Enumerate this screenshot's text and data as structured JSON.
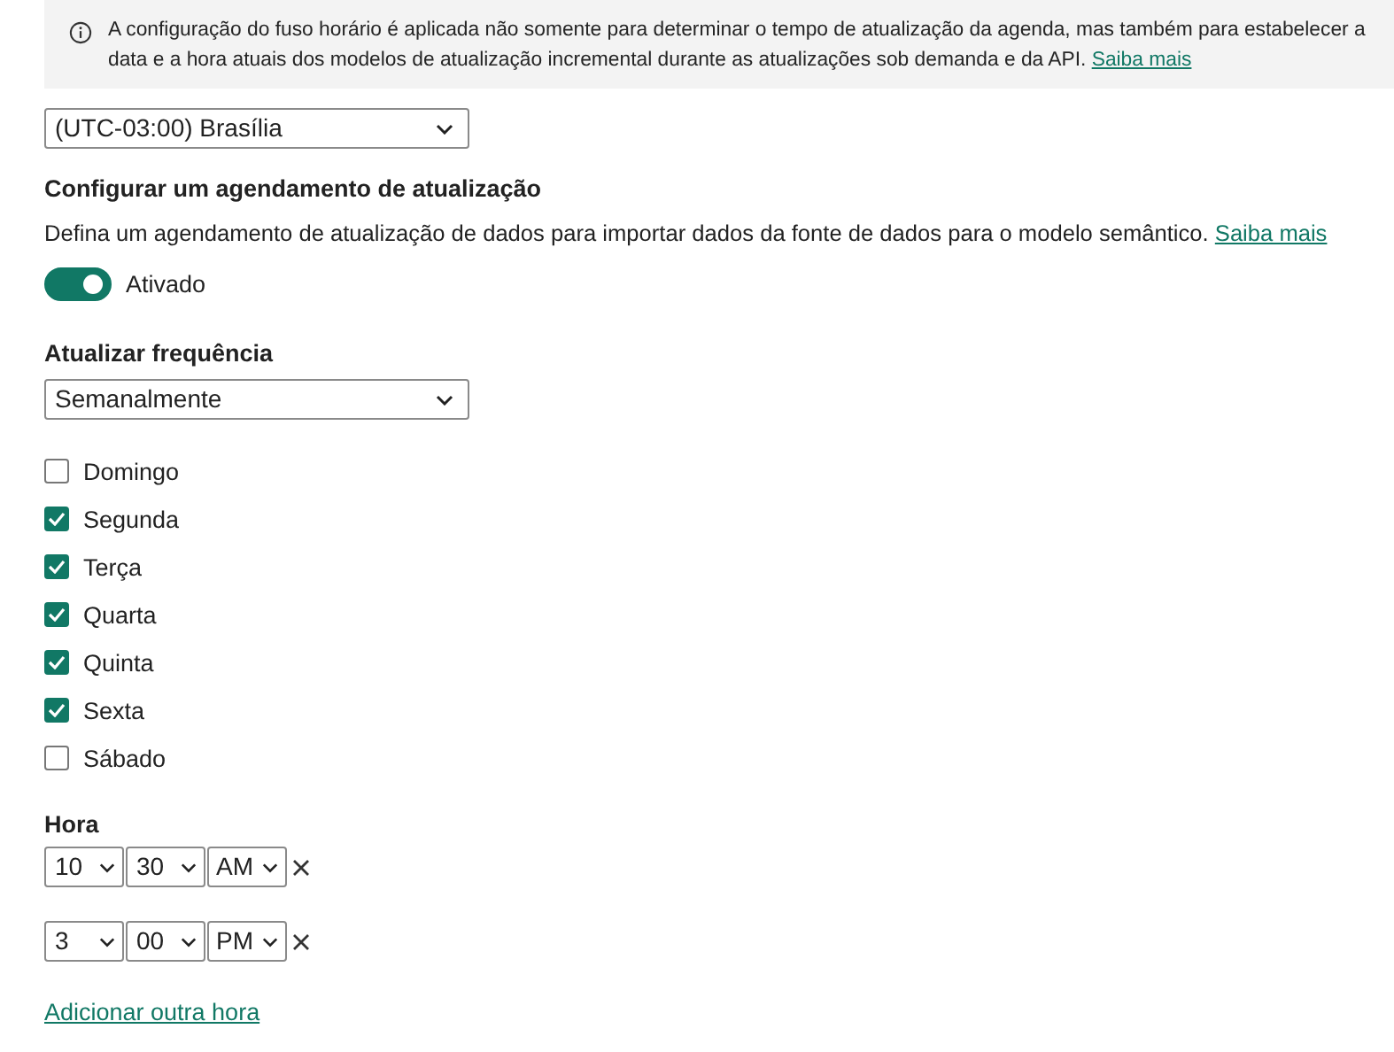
{
  "info_banner": {
    "text": "A configuração do fuso horário é aplicada não somente para determinar o tempo de atualização da agenda, mas também para estabelecer a data e a hora atuais dos modelos de atualização incremental durante as atualizações sob demanda e da API.",
    "link": "Saiba mais"
  },
  "timezone_dropdown": {
    "value": "(UTC-03:00) Brasília"
  },
  "schedule": {
    "heading": "Configurar um agendamento de atualização",
    "description": "Defina um agendamento de atualização de dados para importar dados da fonte de dados para o modelo semântico.",
    "link": "Saiba mais",
    "toggle": {
      "on": true,
      "label": "Ativado"
    }
  },
  "frequency": {
    "heading": "Atualizar frequência",
    "value": "Semanalmente"
  },
  "days": [
    {
      "label": "Domingo",
      "checked": false
    },
    {
      "label": "Segunda",
      "checked": true
    },
    {
      "label": "Terça",
      "checked": true
    },
    {
      "label": "Quarta",
      "checked": true
    },
    {
      "label": "Quinta",
      "checked": true
    },
    {
      "label": "Sexta",
      "checked": true
    },
    {
      "label": "Sábado",
      "checked": false
    }
  ],
  "time": {
    "heading": "Hora",
    "rows": [
      {
        "hour": "10",
        "minute": "30",
        "period": "AM"
      },
      {
        "hour": "3",
        "minute": "00",
        "period": "PM"
      }
    ],
    "add_link": "Adicionar outra hora"
  }
}
